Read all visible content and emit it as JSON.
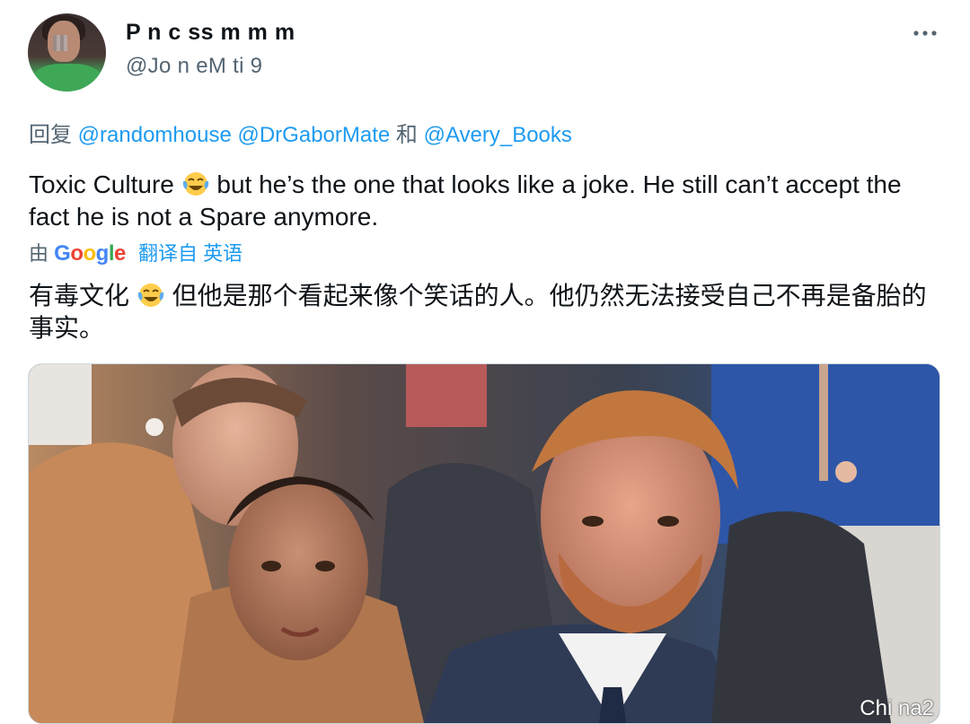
{
  "tweet": {
    "display_name": "P n c ss   m  m  m",
    "handle": "@Jo  n  eM  ti   9",
    "more_icon": "more-icon",
    "reply_prefix": "回复",
    "reply_mentions": [
      "@randomhouse",
      "@DrGaborMate"
    ],
    "reply_and": "和",
    "reply_last": "@Avery_Books",
    "text_part1": "Toxic Culture",
    "text_part2": " but he’s the one that looks like a joke.  He still can’t accept the fact he is not a Spare anymore.",
    "translate_by": "由",
    "translate_logo": "Google",
    "translate_from": "翻译自 英语",
    "translated_part1": "有毒文化",
    "translated_part2": "但他是那个看起来像个笑话的人。他仍然无法接受自己不再是备胎的事实。",
    "emoji": "face-with-tears-of-joy",
    "watermark": "Chi na2"
  },
  "colors": {
    "accent": "#1d9bf0",
    "secondary_text": "#536471",
    "primary_text": "#0f1419"
  }
}
